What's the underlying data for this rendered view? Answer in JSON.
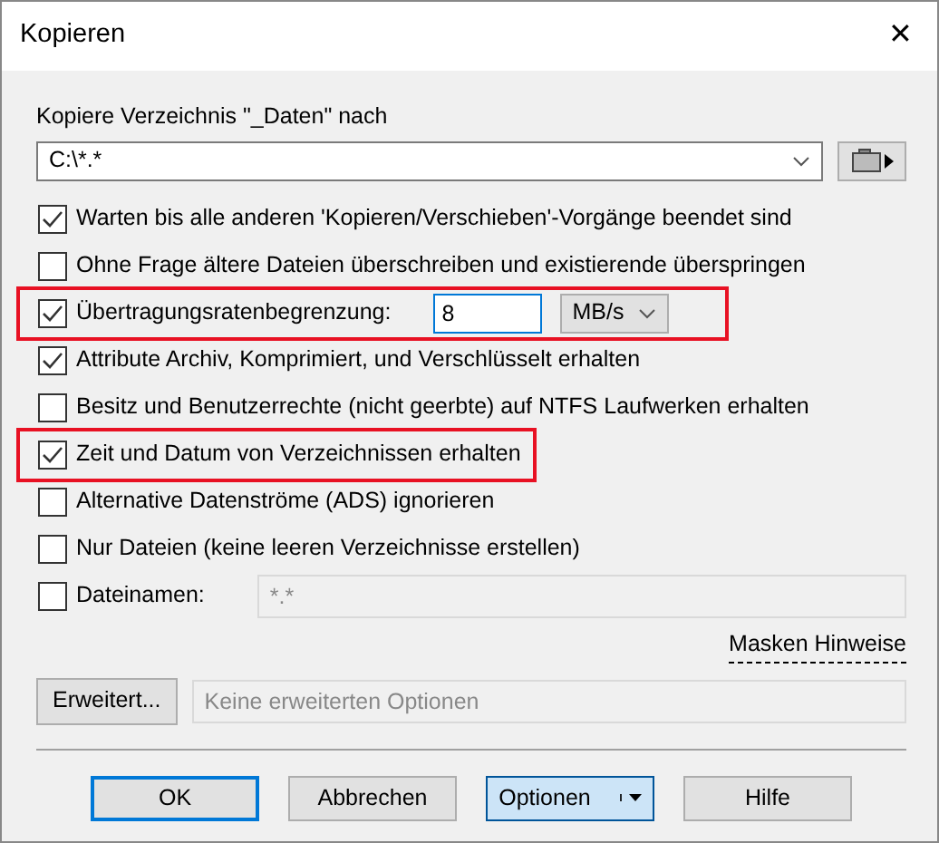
{
  "window": {
    "title": "Kopieren",
    "close": "✕"
  },
  "target": {
    "label": "Kopiere Verzeichnis \"_Daten\" nach",
    "value": "C:\\*.*"
  },
  "options": [
    {
      "kind": "checkbox",
      "label": "Warten bis alle anderen 'Kopieren/Verschieben'-Vorgänge beendet sind",
      "checked": true,
      "highlighted": false
    },
    {
      "kind": "checkbox",
      "label": "Ohne Frage ältere Dateien überschreiben und existierende überspringen",
      "checked": false,
      "highlighted": false
    },
    {
      "kind": "rate",
      "label": "Übertragungsratenbegrenzung:",
      "checked": true,
      "highlighted": true,
      "value": "8",
      "unit": "MB/s"
    },
    {
      "kind": "checkbox",
      "label": "Attribute Archiv, Komprimiert, und Verschlüsselt erhalten",
      "checked": true,
      "highlighted": false
    },
    {
      "kind": "checkbox",
      "label": "Besitz und Benutzerrechte (nicht geerbte) auf NTFS Laufwerken erhalten",
      "checked": false,
      "highlighted": false
    },
    {
      "kind": "checkbox",
      "label": "Zeit und Datum von Verzeichnissen erhalten",
      "checked": true,
      "highlighted": true
    },
    {
      "kind": "checkbox",
      "label": "Alternative Datenströme (ADS) ignorieren",
      "checked": false,
      "highlighted": false
    },
    {
      "kind": "checkbox",
      "label": "Nur Dateien (keine leeren Verzeichnisse erstellen)",
      "checked": false,
      "highlighted": false
    },
    {
      "kind": "filename",
      "label": "Dateinamen:",
      "checked": false,
      "highlighted": false,
      "placeholder": "*.*"
    }
  ],
  "mask_hint": "Masken Hinweise",
  "advanced": {
    "button": "Erweitert...",
    "placeholder": "Keine erweiterten Optionen"
  },
  "buttons": [
    {
      "label": "OK",
      "default": true,
      "split": false
    },
    {
      "label": "Abbrechen",
      "default": false,
      "split": false
    },
    {
      "label": "Optionen",
      "default": false,
      "split": true
    },
    {
      "label": "Hilfe",
      "default": false,
      "split": false
    }
  ]
}
